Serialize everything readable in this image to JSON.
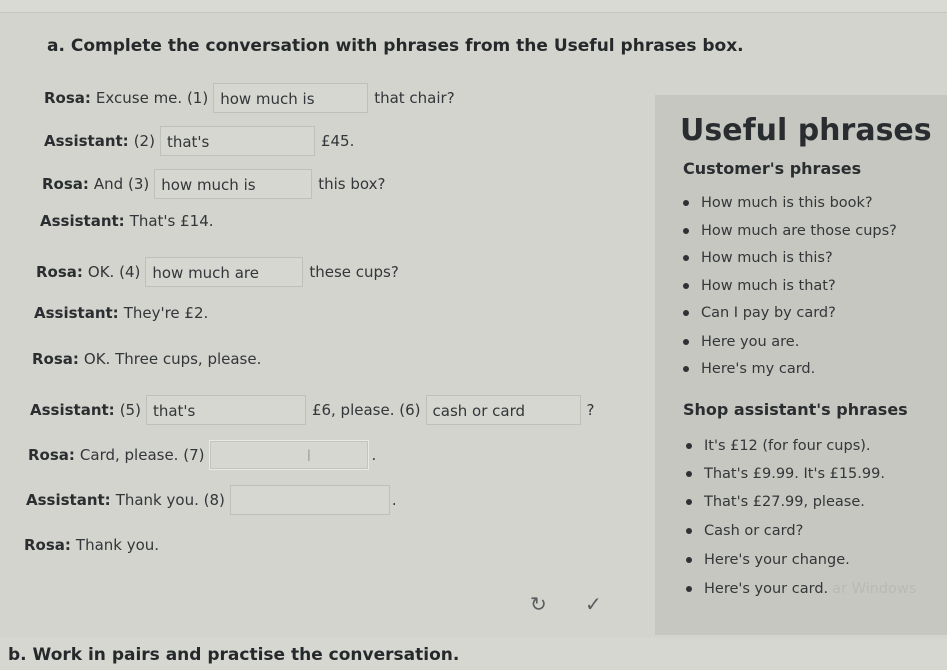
{
  "section_a": "a. Complete the conversation with phrases from the Useful phrases box.",
  "section_b": "b. Work in pairs and practise the conversation.",
  "conversation": [
    {
      "speaker": "Rosa:",
      "before": "Excuse me. (1)",
      "blank": "how much is",
      "after": "that chair?"
    },
    {
      "speaker": "Assistant:",
      "before": "(2)",
      "blank": "that's",
      "after": "£45."
    },
    {
      "speaker": "Rosa:",
      "before": "And (3)",
      "blank": "how much is",
      "after": "this box?"
    },
    {
      "speaker": "Assistant:",
      "before": "That's £14.",
      "blank": "",
      "after": ""
    },
    {
      "speaker": "Rosa:",
      "before": "OK. (4)",
      "blank": "how much are",
      "after": "these cups?"
    },
    {
      "speaker": "Assistant:",
      "before": "They're £2.",
      "blank": "",
      "after": ""
    },
    {
      "speaker": "Rosa:",
      "before": "OK. Three cups, please.",
      "blank": "",
      "after": ""
    },
    {
      "speaker": "Assistant:",
      "before": "(5)",
      "blank": "that's",
      "after": "£6, please. (6)",
      "blank2": "cash or card",
      "after2": "?"
    },
    {
      "speaker": "Rosa:",
      "before": "Card, please. (7)",
      "blank": "",
      "after": "."
    },
    {
      "speaker": "Assistant:",
      "before": "Thank you. (8)",
      "blank": "",
      "after": "."
    },
    {
      "speaker": "Rosa:",
      "before": "Thank you.",
      "blank": "",
      "after": ""
    }
  ],
  "useful": {
    "title": "Useful phrases",
    "customer_title": "Customer's phrases",
    "customer": [
      "How much is this book?",
      "How much are those cups?",
      "How much is this?",
      "How much is that?",
      "Can I pay by card?",
      "Here you are.",
      "Here's my card."
    ],
    "shop_title": "Shop assistant's phrases",
    "shop": [
      "It's £12 (for four cups).",
      "That's £9.99. It's £15.99.",
      "That's £27.99, please.",
      "Cash or card?",
      "Here's your change.",
      "Here's your card."
    ],
    "watermark": "ar Windows"
  },
  "controls": {
    "retry": "↻",
    "check": "✓"
  },
  "caret_glyph": "I",
  "colors": {
    "background": "#d3d4cd",
    "panel": "#c6c7c0",
    "text": "#2c2e30"
  }
}
